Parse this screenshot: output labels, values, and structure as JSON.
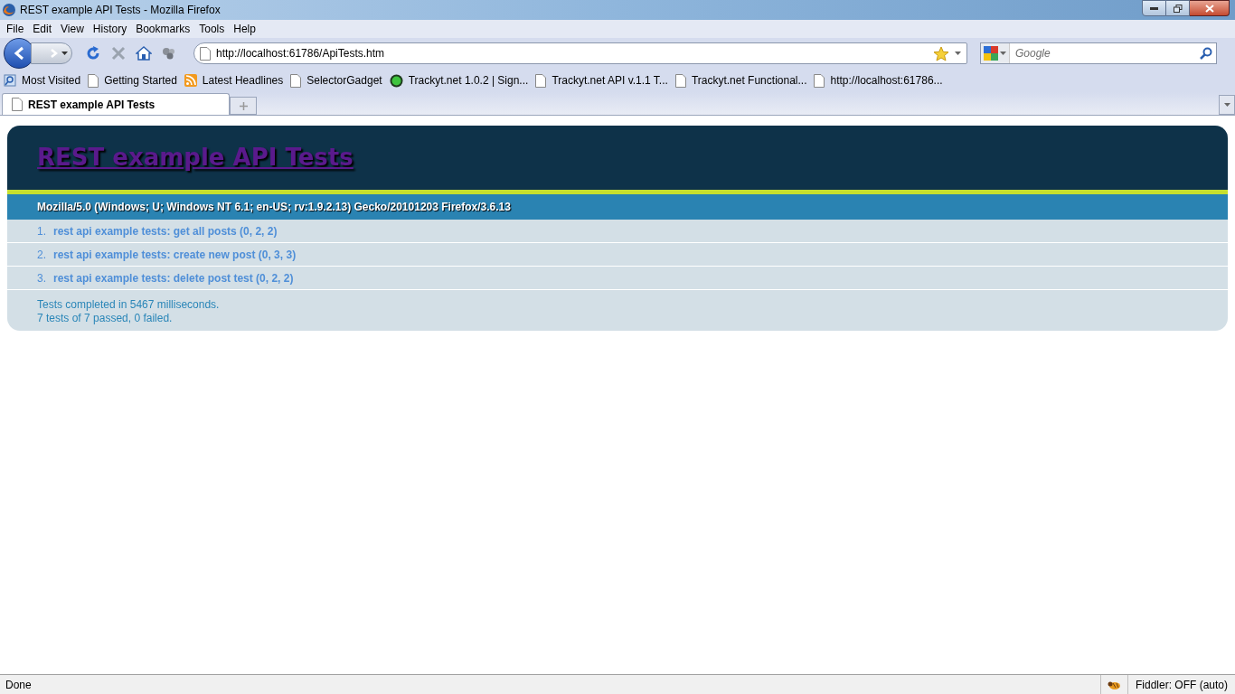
{
  "window": {
    "title": "REST example API Tests - Mozilla Firefox"
  },
  "menu": [
    "File",
    "Edit",
    "View",
    "History",
    "Bookmarks",
    "Tools",
    "Help"
  ],
  "address": {
    "value": "http://localhost:61786/ApiTests.htm"
  },
  "search": {
    "placeholder": "Google"
  },
  "bookmarks": [
    {
      "label": "Most Visited",
      "kind": "folder"
    },
    {
      "label": "Getting Started",
      "kind": "page"
    },
    {
      "label": "Latest Headlines",
      "kind": "feed"
    },
    {
      "label": "SelectorGadget",
      "kind": "page"
    },
    {
      "label": "Trackyt.net 1.0.2 | Sign...",
      "kind": "site"
    },
    {
      "label": "Trackyt.net API v.1.1 T...",
      "kind": "page"
    },
    {
      "label": "Trackyt.net Functional...",
      "kind": "page"
    },
    {
      "label": "http://localhost:61786...",
      "kind": "page"
    }
  ],
  "tabs": [
    {
      "label": "REST example API Tests",
      "selected": true
    }
  ],
  "page": {
    "heading": "REST example API Tests",
    "user_agent": "Mozilla/5.0 (Windows; U; Windows NT 6.1; en-US; rv:1.9.2.13) Gecko/20101203 Firefox/3.6.13",
    "tests": [
      {
        "number": "1.",
        "label": "rest api example tests: get all posts (0, 2, 2)"
      },
      {
        "number": "2.",
        "label": "rest api example tests: create new post (0, 3, 3)"
      },
      {
        "number": "3.",
        "label": "rest api example tests: delete post test (0, 2, 2)"
      }
    ],
    "result_lines": [
      "Tests completed in 5467 milliseconds.",
      "7 tests of 7 passed, 0 failed."
    ]
  },
  "status_bar": {
    "text": "Done",
    "fiddler": "Fiddler: OFF (auto)"
  }
}
